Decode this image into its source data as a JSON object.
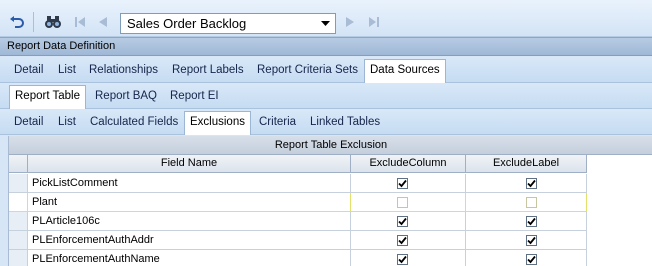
{
  "toolbar": {
    "combo_value": "Sales Order Backlog",
    "icons": [
      "undo-icon",
      "binoculars-icon",
      "first-record-icon",
      "previous-record-icon",
      "chevron-down-icon",
      "next-record-icon",
      "last-record-icon"
    ]
  },
  "section": {
    "title": "Report Data Definition"
  },
  "tabs_level1": [
    "Detail",
    "List",
    "Relationships",
    "Report Labels",
    "Report Criteria Sets",
    "Data Sources"
  ],
  "tabs_level2": [
    "Report Table",
    "Report BAQ",
    "Report EI"
  ],
  "tabs_level3": [
    "Detail",
    "List",
    "Calculated Fields",
    "Exclusions",
    "Criteria",
    "Linked Tables"
  ],
  "grid": {
    "caption": "Report Table Exclusion",
    "columns": [
      "Field Name",
      "ExcludeColumn",
      "ExcludeLabel"
    ],
    "rows": [
      {
        "field": "PickListComment",
        "exclude_column": true,
        "exclude_label": true
      },
      {
        "field": "Plant",
        "exclude_column": false,
        "exclude_label": false
      },
      {
        "field": "PLArticle106c",
        "exclude_column": true,
        "exclude_label": true
      },
      {
        "field": "PLEnforcementAuthAddr",
        "exclude_column": true,
        "exclude_label": true
      },
      {
        "field": "PLEnforcementAuthName",
        "exclude_column": true,
        "exclude_label": true
      }
    ]
  },
  "colors": {
    "highlight": "#fefe58",
    "toolbar": "#d3e4f6",
    "active_tab": "#ffffff"
  }
}
